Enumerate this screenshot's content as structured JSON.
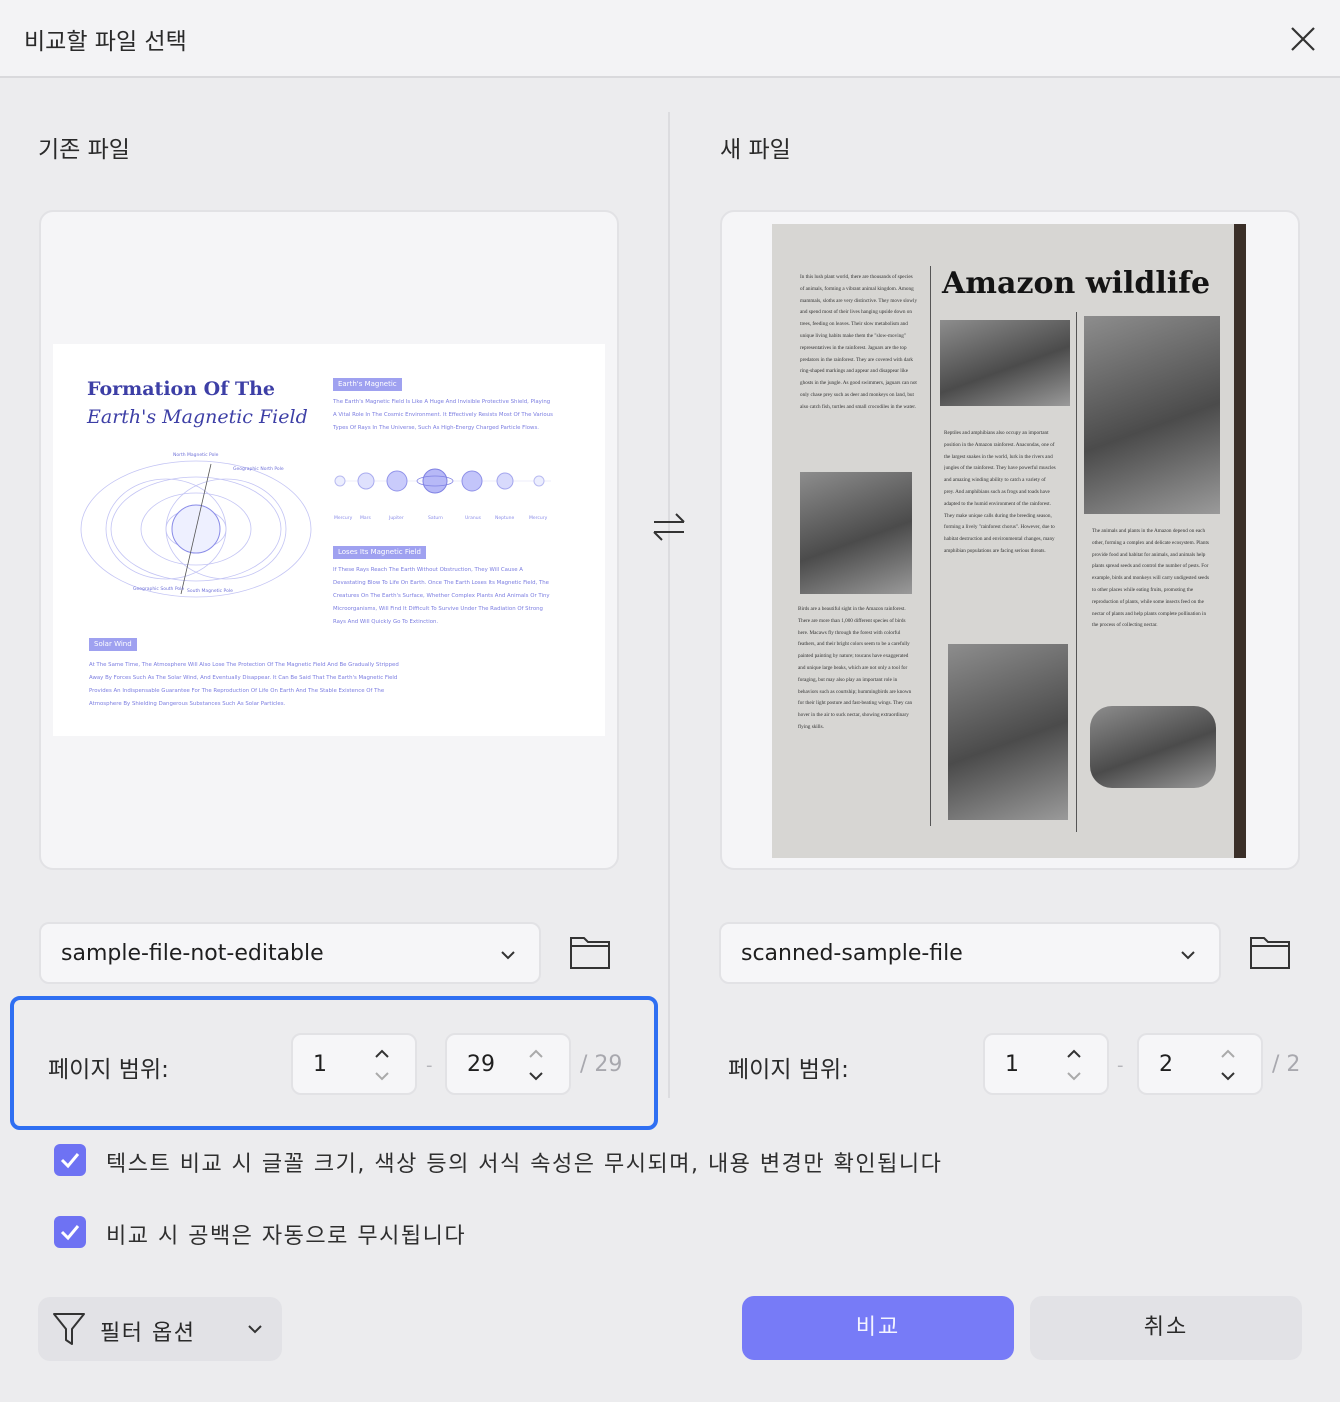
{
  "dialog": {
    "title": "비교할 파일 선택"
  },
  "left": {
    "column_label": "기존 파일",
    "file_select": {
      "value": "sample-file-not-editable"
    },
    "page_range": {
      "label": "페이지 범위:",
      "from": "1",
      "to": "29",
      "dash": "-",
      "total": "/ 29"
    },
    "preview": {
      "title_line1": "Formation Of The",
      "title_line2": "Earth's Magnetic Field",
      "tag1": "Earth's Magnetic",
      "para1": "The Earth's Magnetic Field Is Like A Huge And Invisible Protective Shield, Playing A Vital Role In The Cosmic Environment. It Effectively Resists Most Of The Various Types Of Rays In The Universe, Such As High-Energy Charged Particle Flows.",
      "tag2": "Loses Its Magnetic Field",
      "para2": "If These Rays Reach The Earth Without Obstruction, They Will Cause A Devastating Blow To Life On Earth. Once The Earth Loses Its Magnetic Field, The Creatures On The Earth's Surface, Whether Complex Plants And Animals Or Tiny Microorganisms, Will Find It Difficult To Survive Under The Radiation Of Strong Rays And Will Quickly Go To Extinction.",
      "tag3": "Solar Wind",
      "para3": "At The Same Time, The Atmosphere Will Also Lose The Protection Of The Magnetic Field And Be Gradually Stripped Away By Forces Such As The Solar Wind, And Eventually Disappear. It Can Be Said That The Earth's Magnetic Field Provides An Indispensable Guarantee For The Reproduction Of Life On Earth And The Stable Existence Of The Atmosphere By Shielding Dangerous Substances Such As Solar Particles.",
      "pole_labels": [
        "North Magnetic Pole",
        "Geographic North Pole",
        "Geographic South Pole",
        "South Magnetic Pole"
      ],
      "planets": [
        "Mercury",
        "Mars",
        "Jupiter",
        "Saturn",
        "Uranus",
        "Neptune",
        "Mercury"
      ]
    }
  },
  "right": {
    "column_label": "새 파일",
    "file_select": {
      "value": "scanned-sample-file"
    },
    "page_range": {
      "label": "페이지 범위:",
      "from": "1",
      "to": "2",
      "dash": "-",
      "total": "/ 2"
    },
    "preview": {
      "title": "Amazon wildlife",
      "col1a": "In this lush plant world, there are thousands of species of animals, forming a vibrant animal kingdom. Among mammals, sloths are very distinctive. They move slowly and spend most of their lives hanging upside down on trees, feeding on leaves. Their slow metabolism and unique living habits make them the \"slow-moving\" representatives in the rainforest. Jaguars are the top predators in the rainforest. They are covered with dark ring-shaped markings and appear and disappear like ghosts in the jungle. As good swimmers, jaguars can not only chase prey such as deer and monkeys on land, but also catch fish, turtles and small crocodiles in the water.",
      "col1b": "Birds are a beautiful sight in the Amazon rainforest. There are more than 1,000 different species of birds here. Macaws fly through the forest with colorful feathers, and their bright colors seem to be a carefully painted painting by nature; toucans have exaggerated and unique large beaks, which are not only a tool for foraging, but may also play an important role in behaviors such as courtship; hummingbirds are known for their light posture and fast-beating wings. They can hover in the air to suck nectar, showing extraordinary flying skills.",
      "col2": "Reptiles and amphibians also occupy an important position in the Amazon rainforest. Anacondas, one of the largest snakes in the world, lurk in the rivers and jungles of the rainforest. They have powerful muscles and amazing winding ability to catch a variety of prey. And amphibians such as frogs and toads have adapted to the humid environment of the rainforest. They make unique calls during the breeding season, forming a lively \"rainforest chorus\". However, due to habitat destruction and environmental changes, many amphibian populations are facing serious threats.",
      "col3": "The animals and plants in the Amazon depend on each other, forming a complex and delicate ecosystem. Plants provide food and habitat for animals, and animals help plants spread seeds and control the number of pests. For example, birds and monkeys will carry undigested seeds to other places while eating fruits, promoting the reproduction of plants, while some insects feed on the nectar of plants and help plants complete pollination in the process of collecting nectar."
    }
  },
  "options": {
    "ignore_format": "텍스트 비교 시 글꼴 크기, 색상 등의 서식 속성은 무시되며, 내용 변경만 확인됩니다",
    "ignore_whitespace": "비교 시 공백은 자동으로 무시됩니다"
  },
  "footer": {
    "filter_label": "필터 옵션",
    "compare_label": "비교",
    "cancel_label": "취소"
  },
  "colors": {
    "accent": "#777bf7",
    "focus_border": "#2f6ff2",
    "checkbox": "#6e72f3"
  }
}
